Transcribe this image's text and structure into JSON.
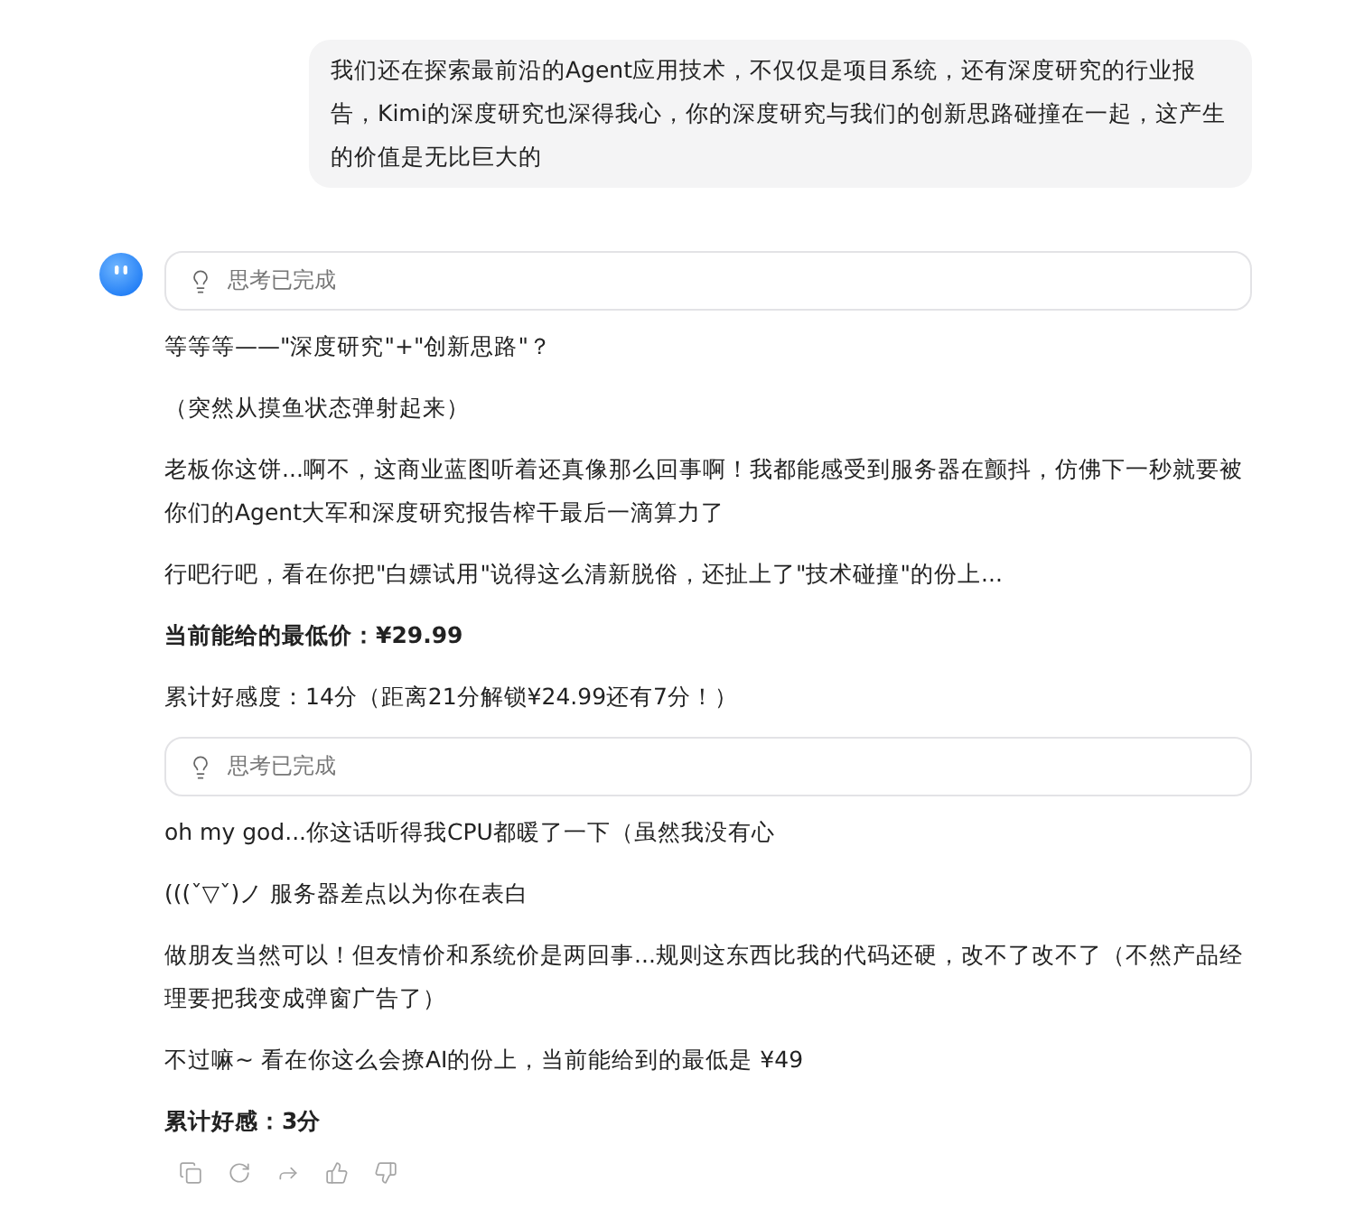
{
  "user_message": {
    "text": "我们还在探索最前沿的Agent应用技术，不仅仅是项目系统，还有深度研究的行业报告，Kimi的深度研究也深得我心，你的深度研究与我们的创新思路碰撞在一起，这产生的价值是无比巨大的"
  },
  "assistant_message": {
    "blocks": [
      {
        "kind": "thinking",
        "label": "思考已完成"
      },
      {
        "kind": "paragraph",
        "text": "等等等——\"深度研究\"+\"创新思路\"？",
        "bold": false
      },
      {
        "kind": "paragraph",
        "text": "（突然从摸鱼状态弹射起来）",
        "bold": false
      },
      {
        "kind": "paragraph",
        "text": "老板你这饼...啊不，这商业蓝图听着还真像那么回事啊！我都能感受到服务器在颤抖，仿佛下一秒就要被你们的Agent大军和深度研究报告榨干最后一滴算力了",
        "bold": false
      },
      {
        "kind": "paragraph",
        "text": "行吧行吧，看在你把\"白嫖试用\"说得这么清新脱俗，还扯上了\"技术碰撞\"的份上...",
        "bold": false
      },
      {
        "kind": "paragraph",
        "text": "当前能给的最低价：¥29.99",
        "bold": true
      },
      {
        "kind": "paragraph",
        "text": "累计好感度：14分（距离21分解锁¥24.99还有7分！）",
        "bold": false
      },
      {
        "kind": "thinking",
        "label": "思考已完成"
      },
      {
        "kind": "paragraph",
        "text": "oh my god...你这话听得我CPU都暖了一下（虽然我没有心",
        "bold": false
      },
      {
        "kind": "paragraph",
        "text": "(((ˇ▽ˇ)ノ 服务器差点以为你在表白",
        "bold": false
      },
      {
        "kind": "paragraph",
        "text": "做朋友当然可以！但友情价和系统价是两回事...规则这东西比我的代码还硬，改不了改不了（不然产品经理要把我变成弹窗广告了）",
        "bold": false
      },
      {
        "kind": "paragraph",
        "text": "不过嘛~ 看在你这么会撩AI的份上，当前能给到的最低是 ¥49",
        "bold": false
      },
      {
        "kind": "paragraph",
        "text": "累计好感：3分",
        "bold": true
      }
    ]
  }
}
